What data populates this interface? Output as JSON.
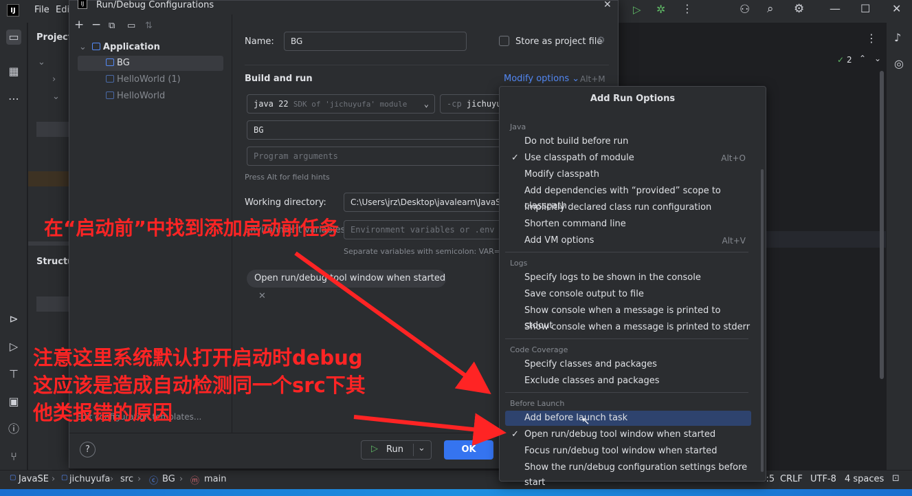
{
  "ide": {
    "menu_file": "File",
    "menu_edit": "Edi",
    "project_label": "Project",
    "structure_label": "Structur",
    "editor_problems_count": "2"
  },
  "dialog": {
    "title": "Run/Debug Configurations",
    "tree": {
      "group": "Application",
      "items": [
        "BG",
        "HelloWorld (1)",
        "HelloWorld"
      ]
    },
    "sidebar_footer_link": "Edit configuration templates...",
    "name_label": "Name:",
    "name_value": "BG",
    "store_label": "Store as project file",
    "build_run_label": "Build and run",
    "modify_options_label": "Modify options",
    "modify_options_shortcut": "Alt+M",
    "jdk_value": "java 22",
    "jdk_detail": "SDK of 'jichuyufa' module",
    "cp_prefix": "-cp",
    "cp_value": "jichuyu",
    "main_class_value": "BG",
    "program_args_placeholder": "Program arguments",
    "field_hint": "Press Alt for field hints",
    "working_dir_label": "Working directory:",
    "working_dir_value": "C:\\Users\\jrz\\Desktop\\javalearn\\JavaS",
    "env_label": "Environment variables:",
    "env_placeholder": "Environment variables or .env f",
    "env_hint": "Separate variables with semicolon: VAR=va",
    "chip_label": "Open run/debug tool window when started",
    "run_button": "Run",
    "ok_button": "OK",
    "help_label": "?"
  },
  "popup": {
    "title": "Add Run Options",
    "sections": [
      {
        "label": "Java",
        "items": [
          {
            "text": "Do not build before run",
            "checked": false,
            "shortcut": ""
          },
          {
            "text": "Use classpath of module",
            "checked": true,
            "shortcut": "Alt+O"
          },
          {
            "text": "Modify classpath",
            "checked": false,
            "shortcut": ""
          },
          {
            "text": "Add dependencies with “provided” scope to classpath",
            "checked": false,
            "shortcut": ""
          },
          {
            "text": "Implicitly declared class run configuration",
            "checked": false,
            "shortcut": ""
          },
          {
            "text": "Shorten command line",
            "checked": false,
            "shortcut": ""
          },
          {
            "text": "Add VM options",
            "checked": false,
            "shortcut": "Alt+V"
          }
        ]
      },
      {
        "label": "Logs",
        "items": [
          {
            "text": "Specify logs to be shown in the console",
            "checked": false,
            "shortcut": ""
          },
          {
            "text": "Save console output to file",
            "checked": false,
            "shortcut": ""
          },
          {
            "text": "Show console when a message is printed to stdout",
            "checked": false,
            "shortcut": ""
          },
          {
            "text": "Show console when a message is printed to stderr",
            "checked": false,
            "shortcut": ""
          }
        ]
      },
      {
        "label": "Code Coverage",
        "items": [
          {
            "text": "Specify classes and packages",
            "checked": false,
            "shortcut": ""
          },
          {
            "text": "Exclude classes and packages",
            "checked": false,
            "shortcut": ""
          }
        ]
      },
      {
        "label": "Before Launch",
        "items": [
          {
            "text": "Add before launch task",
            "checked": false,
            "shortcut": "",
            "selected": true
          },
          {
            "text": "Open run/debug tool window when started",
            "checked": true,
            "shortcut": ""
          },
          {
            "text": "Focus run/debug tool window when started",
            "checked": false,
            "shortcut": ""
          },
          {
            "text": "Show the run/debug configuration settings before start",
            "checked": false,
            "shortcut": ""
          }
        ]
      }
    ]
  },
  "statusbar": {
    "crumbs": [
      "JavaSE",
      "jichuyufa",
      "src",
      "BG",
      "main"
    ],
    "position": "10:5",
    "line_sep": "CRLF",
    "encoding": "UTF-8",
    "indent": "4 spaces"
  },
  "annotations": {
    "note1": "在“启动前”中找到添加启动前任务",
    "note2_line1": "注意这里系统默认打开启动时debug",
    "note2_line2": "这应该是造成自动检测同一个src下其",
    "note2_line3": "他类报错的原因"
  },
  "colors": {
    "accent": "#3574f0",
    "selection": "#2e436e",
    "annotation": "#ff2424",
    "run_green": "#5fb865"
  }
}
